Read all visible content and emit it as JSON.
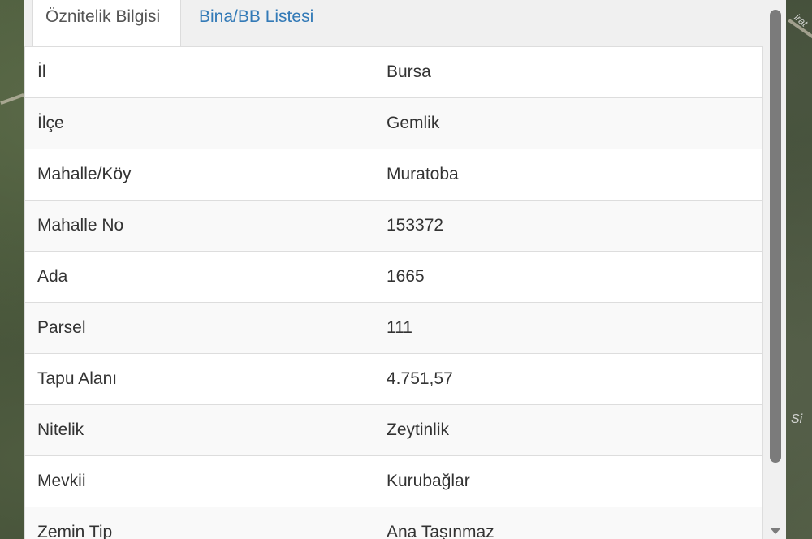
{
  "map": {
    "labels": [
      "Si",
      "irat"
    ]
  },
  "tabs": [
    {
      "label": "Öznitelik Bilgisi",
      "active": true
    },
    {
      "label": "Bina/BB Listesi",
      "active": false
    }
  ],
  "attributes": [
    {
      "key": "İl",
      "value": "Bursa"
    },
    {
      "key": "İlçe",
      "value": "Gemlik"
    },
    {
      "key": "Mahalle/Köy",
      "value": "Muratoba"
    },
    {
      "key": "Mahalle No",
      "value": "153372"
    },
    {
      "key": "Ada",
      "value": "1665"
    },
    {
      "key": "Parsel",
      "value": "111"
    },
    {
      "key": "Tapu Alanı",
      "value": "4.751,57"
    },
    {
      "key": "Nitelik",
      "value": "Zeytinlik"
    },
    {
      "key": "Mevkii",
      "value": "Kurubağlar"
    },
    {
      "key": "Zemin Tip",
      "value": "Ana Taşınmaz"
    }
  ],
  "colors": {
    "tab_link": "#337ab7",
    "text": "#333333",
    "border": "#dddddd"
  }
}
